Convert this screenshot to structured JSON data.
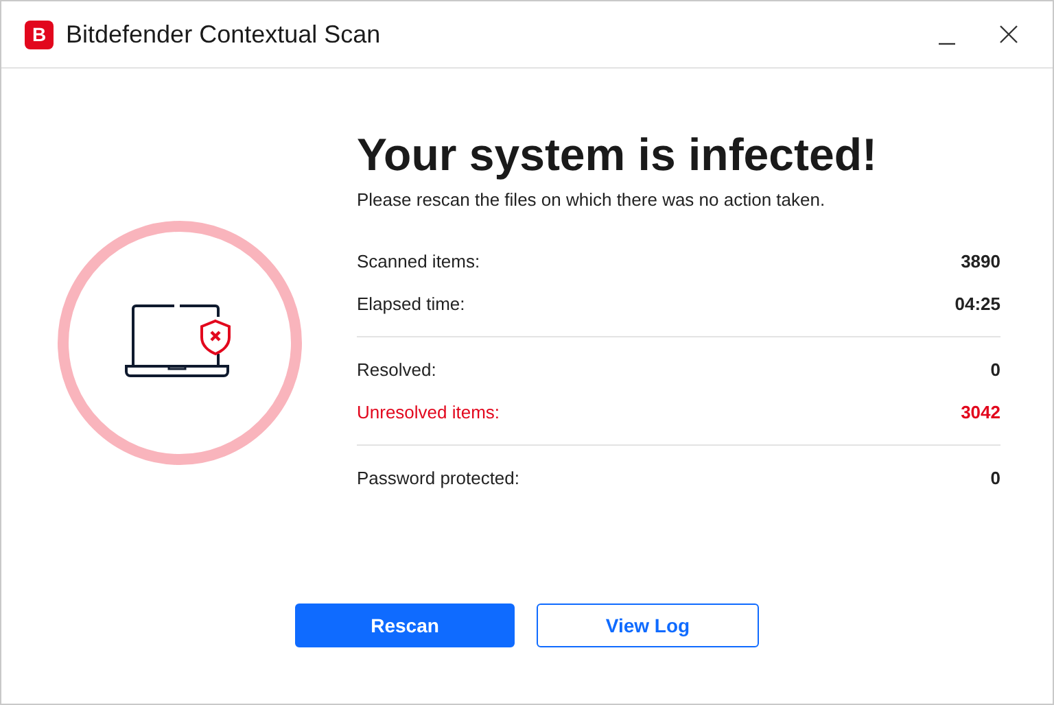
{
  "window": {
    "logo": "B",
    "title": "Bitdefender Contextual Scan"
  },
  "result": {
    "heading": "Your system is infected!",
    "message": "Please rescan the files on which there was no action taken."
  },
  "stat_groups": [
    [
      {
        "label": "Scanned items:",
        "value": "3890",
        "alert": false
      },
      {
        "label": "Elapsed time:",
        "value": "04:25",
        "alert": false
      }
    ],
    [
      {
        "label": "Resolved:",
        "value": "0",
        "alert": false
      },
      {
        "label": "Unresolved items:",
        "value": "3042",
        "alert": true
      }
    ],
    [
      {
        "label": "Password protected:",
        "value": "0",
        "alert": false
      }
    ]
  ],
  "buttons": [
    {
      "label": "Rescan",
      "kind": "primary"
    },
    {
      "label": "View Log",
      "kind": "secondary"
    }
  ]
}
